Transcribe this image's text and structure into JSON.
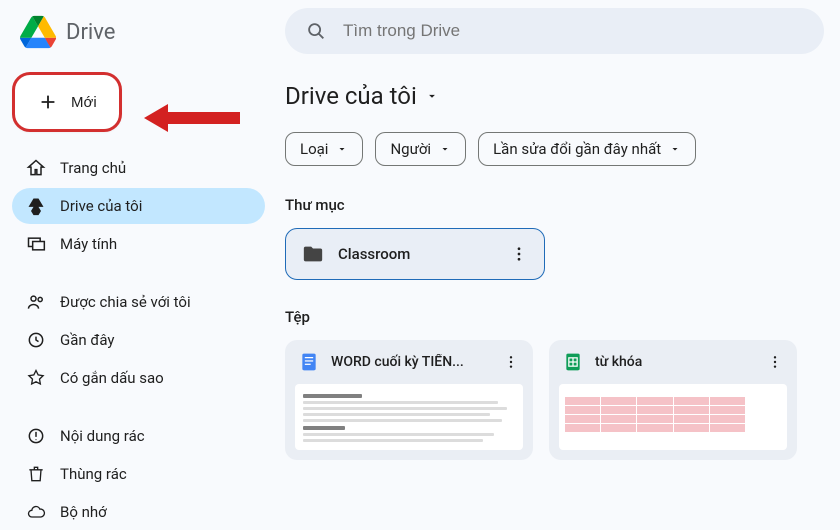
{
  "app": {
    "name": "Drive"
  },
  "search": {
    "placeholder": "Tìm trong Drive"
  },
  "sidebar": {
    "new_label": "Mới",
    "items": [
      {
        "label": "Trang chủ"
      },
      {
        "label": "Drive của tôi"
      },
      {
        "label": "Máy tính"
      },
      {
        "label": "Được chia sẻ với tôi"
      },
      {
        "label": "Gần đây"
      },
      {
        "label": "Có gắn dấu sao"
      },
      {
        "label": "Nội dung rác"
      },
      {
        "label": "Thùng rác"
      },
      {
        "label": "Bộ nhớ"
      }
    ]
  },
  "main": {
    "title": "Drive của tôi",
    "filters": [
      {
        "label": "Loại"
      },
      {
        "label": "Người"
      },
      {
        "label": "Lần sửa đổi gần đây nhất"
      }
    ],
    "folders_label": "Thư mục",
    "folders": [
      {
        "name": "Classroom"
      }
    ],
    "files_label": "Tệp",
    "files": [
      {
        "name": "WORD cuối kỳ TIẾN...",
        "type": "docs"
      },
      {
        "name": "từ khóa",
        "type": "sheets"
      }
    ]
  }
}
